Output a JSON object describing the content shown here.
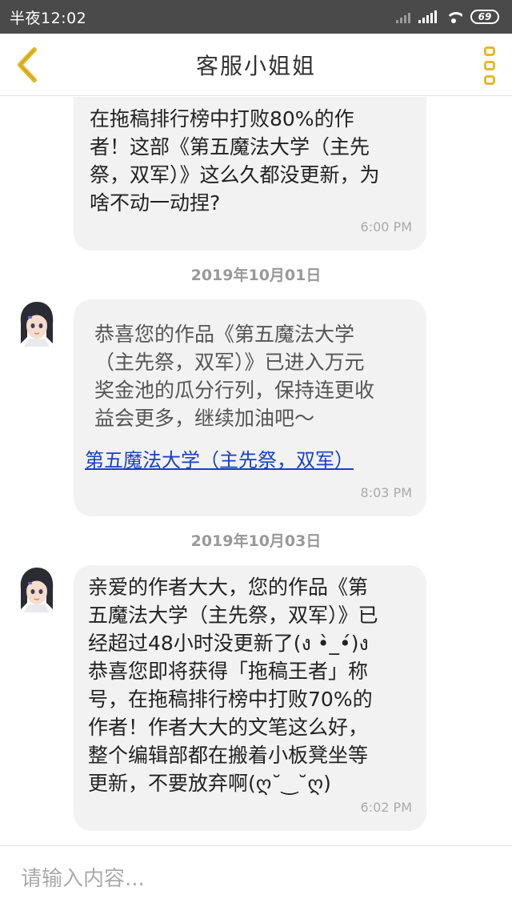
{
  "status_bar": {
    "time": "半夜12:02",
    "battery": "69"
  },
  "header": {
    "title": "客服小姐姐",
    "back_icon": "chevron-left-icon",
    "more_icon": "more-vertical-icon",
    "accent_color": "#e5b92a"
  },
  "messages": [
    {
      "text": "在拖稿排行榜中打败80%的作\n者！这部《第五魔法大学（主先\n祭，双军）》这么久都没更新，为\n啥不动一动捏?",
      "time": "6:00 PM"
    },
    {
      "date": "2019年10月01日",
      "text": "恭喜您的作品《第五魔法大学\n（主先祭，双军）》已进入万元\n奖金池的瓜分行列，保持连更收\n益会更多，继续加油吧～",
      "link": "第五魔法大学（主先祭，双军）",
      "time": "8:03 PM"
    },
    {
      "date": "2019年10月03日",
      "text": "亲爱的作者大大，您的作品《第\n五魔法大学（主先祭，双军）》已\n经超过48小时没更新了(ง •̀_•́)ง\n恭喜您即将获得「拖稿王者」称\n号，在拖稿排行榜中打败70%的\n作者！作者大大的文笔这么好，\n整个编辑部都在搬着小板凳坐等\n更新，不要放弃啊(ღ˘‿˘ღ)",
      "time": "6:02 PM"
    }
  ],
  "input": {
    "placeholder": "请输入内容..."
  }
}
